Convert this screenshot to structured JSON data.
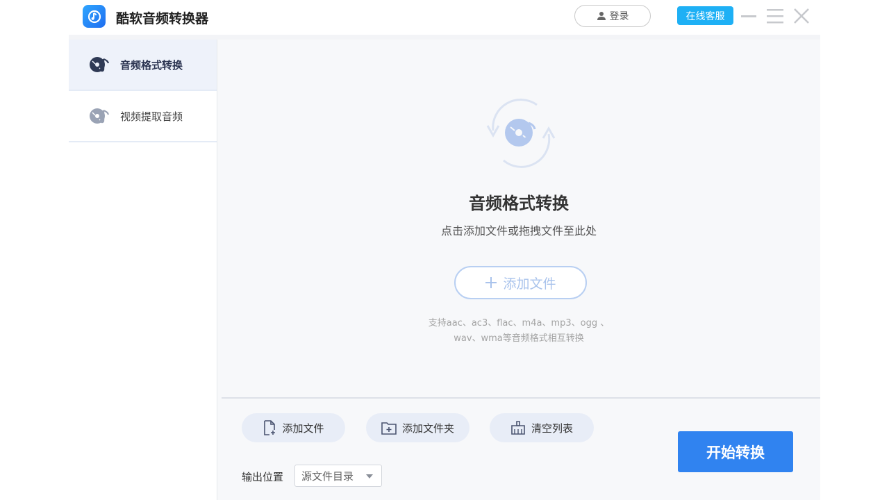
{
  "app": {
    "title": "酷软音频转换器"
  },
  "header": {
    "login_label": "登录",
    "service_label": "在线客服"
  },
  "sidebar": {
    "items": [
      {
        "label": "音频格式转换",
        "active": true
      },
      {
        "label": "视频提取音频",
        "active": false
      }
    ]
  },
  "main": {
    "title": "音频格式转换",
    "subtitle": "点击添加文件或拖拽文件至此处",
    "add_file_label": "添加文件",
    "formats_line1": "支持aac、ac3、flac、m4a、mp3、ogg 、",
    "formats_line2": "wav、wma等音频格式相互转换"
  },
  "toolbar": {
    "add_file": "添加文件",
    "add_folder": "添加文件夹",
    "clear_list": "清空列表",
    "start": "开始转换"
  },
  "output": {
    "label": "输出位置",
    "selected": "源文件目录"
  },
  "colors": {
    "primary": "#3083f0",
    "service": "#1eb0f5",
    "active_bg": "#eef2fa",
    "pill_bg": "#e8edf7"
  }
}
